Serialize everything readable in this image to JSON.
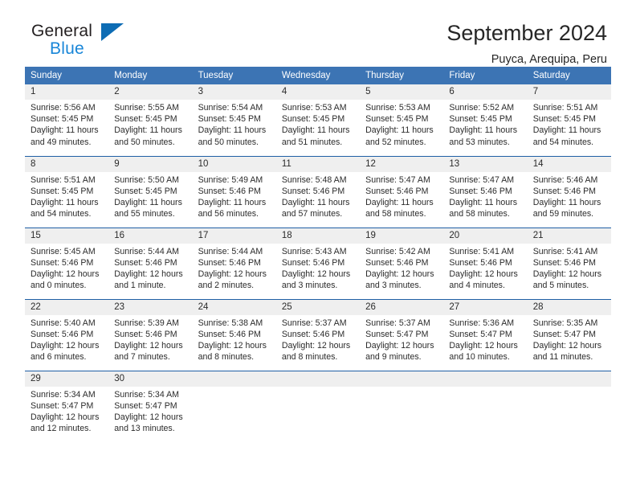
{
  "brand": {
    "name_top": "General",
    "name_bottom": "Blue",
    "triangle_color": "#0d6cb4",
    "blue_text_color": "#1886d8"
  },
  "header": {
    "title": "September 2024",
    "location": "Puyca, Arequipa, Peru"
  },
  "theme": {
    "header_blue": "#3c74b4",
    "row_divider_blue": "#1f5fa5",
    "daynum_band_gray": "#efefef"
  },
  "calendar": {
    "weekday_headers": [
      "Sunday",
      "Monday",
      "Tuesday",
      "Wednesday",
      "Thursday",
      "Friday",
      "Saturday"
    ],
    "labels": {
      "sunrise": "Sunrise:",
      "sunset": "Sunset:",
      "daylight": "Daylight:"
    },
    "weeks": [
      [
        {
          "day": "1",
          "sunrise": "Sunrise: 5:56 AM",
          "sunset": "Sunset: 5:45 PM",
          "daylight1": "Daylight: 11 hours",
          "daylight2": "and 49 minutes."
        },
        {
          "day": "2",
          "sunrise": "Sunrise: 5:55 AM",
          "sunset": "Sunset: 5:45 PM",
          "daylight1": "Daylight: 11 hours",
          "daylight2": "and 50 minutes."
        },
        {
          "day": "3",
          "sunrise": "Sunrise: 5:54 AM",
          "sunset": "Sunset: 5:45 PM",
          "daylight1": "Daylight: 11 hours",
          "daylight2": "and 50 minutes."
        },
        {
          "day": "4",
          "sunrise": "Sunrise: 5:53 AM",
          "sunset": "Sunset: 5:45 PM",
          "daylight1": "Daylight: 11 hours",
          "daylight2": "and 51 minutes."
        },
        {
          "day": "5",
          "sunrise": "Sunrise: 5:53 AM",
          "sunset": "Sunset: 5:45 PM",
          "daylight1": "Daylight: 11 hours",
          "daylight2": "and 52 minutes."
        },
        {
          "day": "6",
          "sunrise": "Sunrise: 5:52 AM",
          "sunset": "Sunset: 5:45 PM",
          "daylight1": "Daylight: 11 hours",
          "daylight2": "and 53 minutes."
        },
        {
          "day": "7",
          "sunrise": "Sunrise: 5:51 AM",
          "sunset": "Sunset: 5:45 PM",
          "daylight1": "Daylight: 11 hours",
          "daylight2": "and 54 minutes."
        }
      ],
      [
        {
          "day": "8",
          "sunrise": "Sunrise: 5:51 AM",
          "sunset": "Sunset: 5:45 PM",
          "daylight1": "Daylight: 11 hours",
          "daylight2": "and 54 minutes."
        },
        {
          "day": "9",
          "sunrise": "Sunrise: 5:50 AM",
          "sunset": "Sunset: 5:45 PM",
          "daylight1": "Daylight: 11 hours",
          "daylight2": "and 55 minutes."
        },
        {
          "day": "10",
          "sunrise": "Sunrise: 5:49 AM",
          "sunset": "Sunset: 5:46 PM",
          "daylight1": "Daylight: 11 hours",
          "daylight2": "and 56 minutes."
        },
        {
          "day": "11",
          "sunrise": "Sunrise: 5:48 AM",
          "sunset": "Sunset: 5:46 PM",
          "daylight1": "Daylight: 11 hours",
          "daylight2": "and 57 minutes."
        },
        {
          "day": "12",
          "sunrise": "Sunrise: 5:47 AM",
          "sunset": "Sunset: 5:46 PM",
          "daylight1": "Daylight: 11 hours",
          "daylight2": "and 58 minutes."
        },
        {
          "day": "13",
          "sunrise": "Sunrise: 5:47 AM",
          "sunset": "Sunset: 5:46 PM",
          "daylight1": "Daylight: 11 hours",
          "daylight2": "and 58 minutes."
        },
        {
          "day": "14",
          "sunrise": "Sunrise: 5:46 AM",
          "sunset": "Sunset: 5:46 PM",
          "daylight1": "Daylight: 11 hours",
          "daylight2": "and 59 minutes."
        }
      ],
      [
        {
          "day": "15",
          "sunrise": "Sunrise: 5:45 AM",
          "sunset": "Sunset: 5:46 PM",
          "daylight1": "Daylight: 12 hours",
          "daylight2": "and 0 minutes."
        },
        {
          "day": "16",
          "sunrise": "Sunrise: 5:44 AM",
          "sunset": "Sunset: 5:46 PM",
          "daylight1": "Daylight: 12 hours",
          "daylight2": "and 1 minute."
        },
        {
          "day": "17",
          "sunrise": "Sunrise: 5:44 AM",
          "sunset": "Sunset: 5:46 PM",
          "daylight1": "Daylight: 12 hours",
          "daylight2": "and 2 minutes."
        },
        {
          "day": "18",
          "sunrise": "Sunrise: 5:43 AM",
          "sunset": "Sunset: 5:46 PM",
          "daylight1": "Daylight: 12 hours",
          "daylight2": "and 3 minutes."
        },
        {
          "day": "19",
          "sunrise": "Sunrise: 5:42 AM",
          "sunset": "Sunset: 5:46 PM",
          "daylight1": "Daylight: 12 hours",
          "daylight2": "and 3 minutes."
        },
        {
          "day": "20",
          "sunrise": "Sunrise: 5:41 AM",
          "sunset": "Sunset: 5:46 PM",
          "daylight1": "Daylight: 12 hours",
          "daylight2": "and 4 minutes."
        },
        {
          "day": "21",
          "sunrise": "Sunrise: 5:41 AM",
          "sunset": "Sunset: 5:46 PM",
          "daylight1": "Daylight: 12 hours",
          "daylight2": "and 5 minutes."
        }
      ],
      [
        {
          "day": "22",
          "sunrise": "Sunrise: 5:40 AM",
          "sunset": "Sunset: 5:46 PM",
          "daylight1": "Daylight: 12 hours",
          "daylight2": "and 6 minutes."
        },
        {
          "day": "23",
          "sunrise": "Sunrise: 5:39 AM",
          "sunset": "Sunset: 5:46 PM",
          "daylight1": "Daylight: 12 hours",
          "daylight2": "and 7 minutes."
        },
        {
          "day": "24",
          "sunrise": "Sunrise: 5:38 AM",
          "sunset": "Sunset: 5:46 PM",
          "daylight1": "Daylight: 12 hours",
          "daylight2": "and 8 minutes."
        },
        {
          "day": "25",
          "sunrise": "Sunrise: 5:37 AM",
          "sunset": "Sunset: 5:46 PM",
          "daylight1": "Daylight: 12 hours",
          "daylight2": "and 8 minutes."
        },
        {
          "day": "26",
          "sunrise": "Sunrise: 5:37 AM",
          "sunset": "Sunset: 5:47 PM",
          "daylight1": "Daylight: 12 hours",
          "daylight2": "and 9 minutes."
        },
        {
          "day": "27",
          "sunrise": "Sunrise: 5:36 AM",
          "sunset": "Sunset: 5:47 PM",
          "daylight1": "Daylight: 12 hours",
          "daylight2": "and 10 minutes."
        },
        {
          "day": "28",
          "sunrise": "Sunrise: 5:35 AM",
          "sunset": "Sunset: 5:47 PM",
          "daylight1": "Daylight: 12 hours",
          "daylight2": "and 11 minutes."
        }
      ],
      [
        {
          "day": "29",
          "sunrise": "Sunrise: 5:34 AM",
          "sunset": "Sunset: 5:47 PM",
          "daylight1": "Daylight: 12 hours",
          "daylight2": "and 12 minutes."
        },
        {
          "day": "30",
          "sunrise": "Sunrise: 5:34 AM",
          "sunset": "Sunset: 5:47 PM",
          "daylight1": "Daylight: 12 hours",
          "daylight2": "and 13 minutes."
        },
        {
          "day": "",
          "sunrise": "",
          "sunset": "",
          "daylight1": "",
          "daylight2": ""
        },
        {
          "day": "",
          "sunrise": "",
          "sunset": "",
          "daylight1": "",
          "daylight2": ""
        },
        {
          "day": "",
          "sunrise": "",
          "sunset": "",
          "daylight1": "",
          "daylight2": ""
        },
        {
          "day": "",
          "sunrise": "",
          "sunset": "",
          "daylight1": "",
          "daylight2": ""
        },
        {
          "day": "",
          "sunrise": "",
          "sunset": "",
          "daylight1": "",
          "daylight2": ""
        }
      ]
    ]
  }
}
